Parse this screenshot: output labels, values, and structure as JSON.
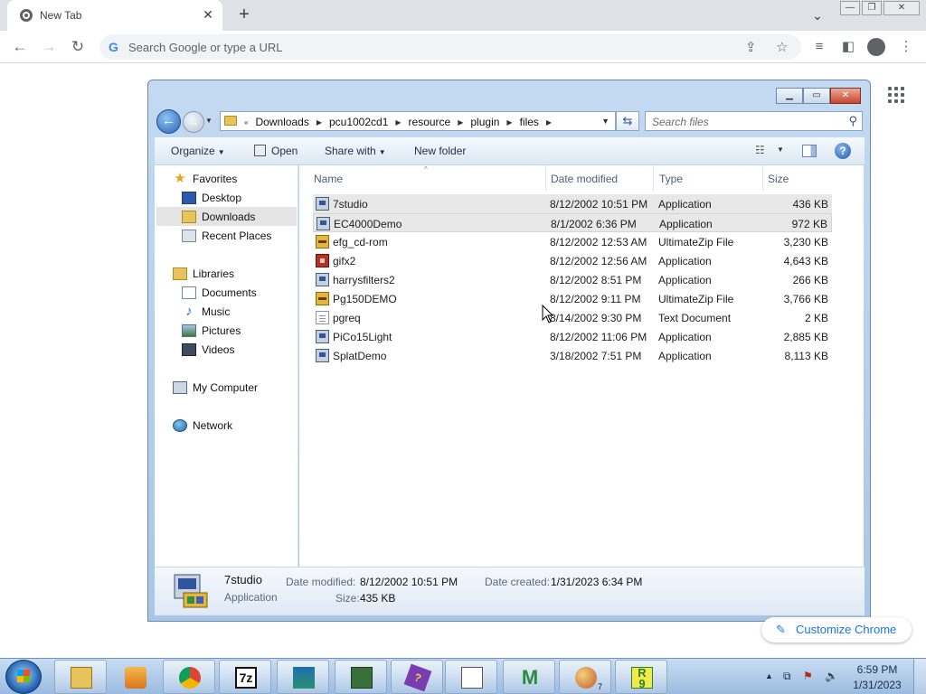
{
  "browser": {
    "tab_title": "New Tab",
    "omnibox_placeholder": "Search Google or type a URL",
    "customize_label": "Customize Chrome"
  },
  "explorer": {
    "breadcrumbs": [
      "Downloads",
      "pcu1002cd1",
      "resource",
      "plugin",
      "files"
    ],
    "search_placeholder": "Search files",
    "commands": {
      "organize": "Organize",
      "open": "Open",
      "share": "Share with",
      "new_folder": "New folder"
    },
    "nav": {
      "favorites": "Favorites",
      "favorites_items": [
        "Desktop",
        "Downloads",
        "Recent Places"
      ],
      "libraries": "Libraries",
      "libraries_items": [
        "Documents",
        "Music",
        "Pictures",
        "Videos"
      ],
      "computer": "My Computer",
      "network": "Network"
    },
    "columns": [
      "Name",
      "Date modified",
      "Type",
      "Size"
    ],
    "files": [
      {
        "name": "7studio",
        "date": "8/12/2002 10:51 PM",
        "type": "Application",
        "size": "436 KB",
        "icon": "app-icon"
      },
      {
        "name": "EC4000Demo",
        "date": "8/1/2002 6:36 PM",
        "type": "Application",
        "size": "972 KB",
        "icon": "app-icon"
      },
      {
        "name": "efg_cd-rom",
        "date": "8/12/2002 12:53 AM",
        "type": "UltimateZip File",
        "size": "3,230 KB",
        "icon": "zip-icon"
      },
      {
        "name": "gifx2",
        "date": "8/12/2002 12:56 AM",
        "type": "Application",
        "size": "4,643 KB",
        "icon": "app-icon"
      },
      {
        "name": "harrysfilters2",
        "date": "8/12/2002 8:51 PM",
        "type": "Application",
        "size": "266 KB",
        "icon": "app-icon"
      },
      {
        "name": "Pg150DEMO",
        "date": "8/12/2002 9:11 PM",
        "type": "UltimateZip File",
        "size": "3,766 KB",
        "icon": "zip-icon"
      },
      {
        "name": "pgreq",
        "date": "8/14/2002 9:30 PM",
        "type": "Text Document",
        "size": "2 KB",
        "icon": "text-file-icon"
      },
      {
        "name": "PiCo15Light",
        "date": "8/12/2002 11:06 PM",
        "type": "Application",
        "size": "2,885 KB",
        "icon": "app-icon"
      },
      {
        "name": "SplatDemo",
        "date": "3/18/2002 7:51 PM",
        "type": "Application",
        "size": "8,113 KB",
        "icon": "app-icon"
      }
    ],
    "details": {
      "name": "7studio",
      "type": "Application",
      "date_modified_label": "Date modified:",
      "date_modified": "8/12/2002 10:51 PM",
      "date_created_label": "Date created:",
      "date_created": "1/31/2023 6:34 PM",
      "size_label": "Size:",
      "size": "435 KB"
    }
  },
  "taskbar": {
    "time": "6:59 PM",
    "date": "1/31/2023",
    "badge_7": "7"
  }
}
